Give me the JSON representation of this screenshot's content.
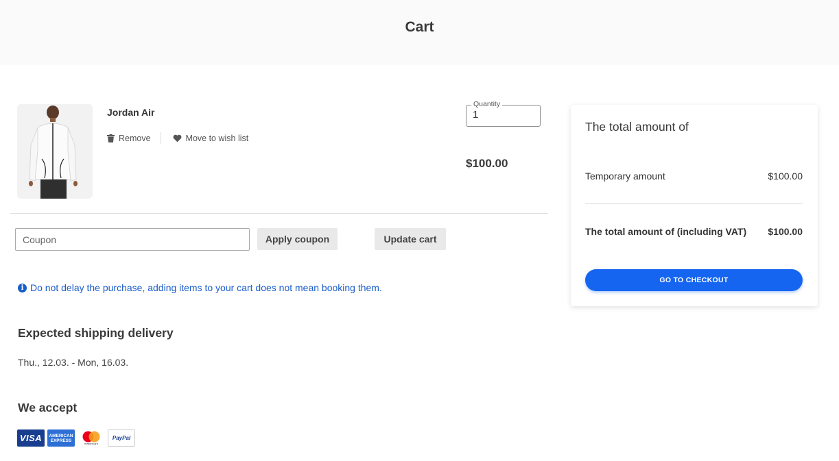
{
  "header": {
    "title": "Cart"
  },
  "cart": {
    "item": {
      "name": "Jordan Air",
      "remove_label": "Remove",
      "wishlist_label": "Move to wish list",
      "quantity_label": "Quantity",
      "quantity_value": "1",
      "price": "$100.00"
    },
    "coupon_placeholder": "Coupon",
    "apply_coupon_label": "Apply coupon",
    "update_cart_label": "Update cart",
    "notice": "Do not delay the purchase, adding items to your cart does not mean booking them."
  },
  "shipping": {
    "heading": "Expected shipping delivery",
    "dates": "Thu., 12.03. - Mon, 16.03."
  },
  "payments": {
    "heading": "We accept",
    "visa_text": "VISA",
    "amex_line1": "AMERICAN",
    "amex_line2": "EXPRESS",
    "mastercard_text": "mastercard",
    "paypal_text": "PayPal"
  },
  "summary": {
    "title": "The total amount of",
    "temp_label": "Temporary amount",
    "temp_value": "$100.00",
    "total_label": "The total amount of (including VAT)",
    "total_value": "$100.00",
    "checkout_label": "GO TO CHECKOUT"
  },
  "colors": {
    "accent": "#1565f0",
    "notice": "#1a5dc9",
    "header_bg": "#fbfafa"
  }
}
